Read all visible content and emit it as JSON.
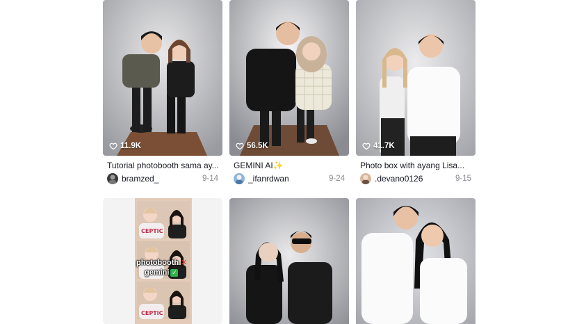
{
  "colors": {
    "text": "#161823",
    "muted": "#8a8b91",
    "accent_sparkle": "#f5c518",
    "check": "#2fb34a",
    "cross": "#e0302f"
  },
  "icons": {
    "likes": "heart-outline-icon",
    "sparkle": "sparkle-emoji-icon",
    "check": "check-mark-emoji-icon",
    "cross": "cross-mark-emoji-icon"
  },
  "videos": [
    {
      "likes": "11.9K",
      "caption": "Tutorial photobooth sama ay...",
      "user": "bramzed_",
      "date": "9-14"
    },
    {
      "likes": "56.5K",
      "caption": "GEMINI AI",
      "caption_emoji": "✨",
      "user": "_ifanrdwan",
      "date": "9-24"
    },
    {
      "likes": "41.7K",
      "caption": "Photo box with ayang Lisa...",
      "user": ".devano0126",
      "date": "9-15"
    }
  ],
  "second_row": {
    "strip_text_1": "photobooth",
    "strip_text_1_emoji": "✕",
    "strip_text_2": "gemini",
    "strip_text_2_emoji": "✓",
    "shirt_text": "CEPTIC"
  }
}
